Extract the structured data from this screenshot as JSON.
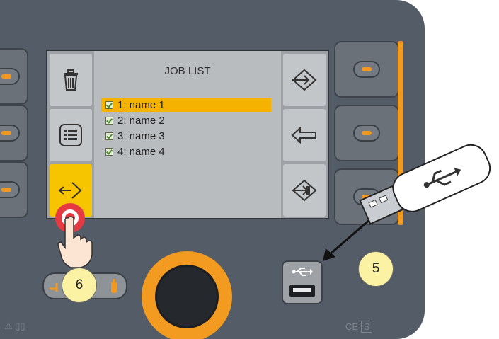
{
  "screen": {
    "title": "JOB LIST",
    "jobs": [
      {
        "label": "1: name 1",
        "checked": true,
        "selected": true
      },
      {
        "label": "2: name 2",
        "checked": true,
        "selected": false
      },
      {
        "label": "3: name 3",
        "checked": true,
        "selected": false
      },
      {
        "label": "4: name 4",
        "checked": true,
        "selected": false
      }
    ],
    "left_icons": [
      "trash-icon",
      "list-icon",
      "export-icon"
    ],
    "right_icons": [
      "import-icon",
      "back-arrow-icon",
      "save-icon"
    ]
  },
  "callouts": {
    "step_6": "6",
    "step_5": "5"
  },
  "markings": {
    "ce": "CE"
  },
  "colors": {
    "accent": "#f29a1f",
    "selection": "#f6b200",
    "active_key": "#f6c500",
    "panel": "#545c68"
  }
}
